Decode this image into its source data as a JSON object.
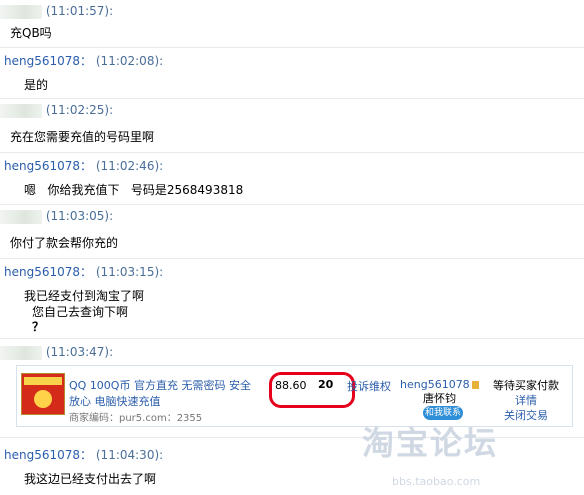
{
  "messages": [
    {
      "sender": "",
      "time": "(11:01:57):",
      "lines": [
        "充QB吗"
      ]
    },
    {
      "sender": "heng561078",
      "sep": "：",
      "time": "(11:02:08):",
      "lines": [
        "是的"
      ]
    },
    {
      "sender": "",
      "time": "(11:02:25):",
      "lines": [
        "充在您需要充值的号码里啊"
      ]
    },
    {
      "sender": "heng561078",
      "sep": "：",
      "time": "(11:02:46):",
      "lines": [
        "嗯   你给我充值下   号码是2568493818"
      ]
    },
    {
      "sender": "",
      "time": "(11:03:05):",
      "lines": [
        "你付了款会帮你充的"
      ]
    },
    {
      "sender": "heng561078",
      "sep": "：",
      "time": "(11:03:15):",
      "lines": [
        "我已经支付到淘宝了啊",
        "您自己去查询下啊",
        "？"
      ]
    },
    {
      "sender": "",
      "time": "(11:03:47):",
      "lines": []
    },
    {
      "sender": "heng561078",
      "sep": "：",
      "time": "(11:04:30):",
      "lines": [
        "我这边已经支付出去了啊"
      ]
    }
  ],
  "order_card": {
    "title": "QQ 100Q币 官方直充 无需密码 安全放心 电脑快速充值",
    "merchant_code": "商家编码：pur5.com：2355",
    "price": "88.60",
    "quantity": "20",
    "complaint_link": "投诉维权",
    "seller_name": "heng561078",
    "seller_realname": "唐怀钧",
    "contact_button": "和我联系",
    "status": "等待买家付款",
    "detail_link": "详情",
    "close_link": "关闭交易"
  },
  "watermark": {
    "text": "淘宝论坛",
    "url": "bbs.taobao.com"
  },
  "colors": {
    "link": "#2a5dac",
    "highlight_box": "#e6001b"
  }
}
